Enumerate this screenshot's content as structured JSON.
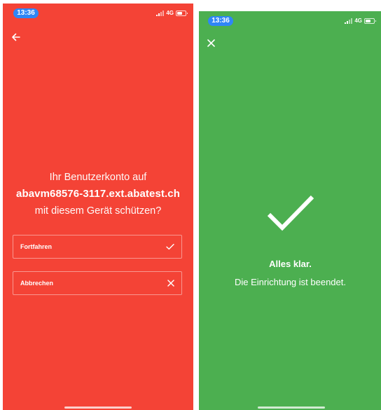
{
  "colors": {
    "left_screen_bg": "#f44336",
    "right_screen_bg": "#4caf50",
    "time_pill_bg": "#2f86f6",
    "foreground": "#ffffff"
  },
  "left_screen": {
    "status_bar": {
      "time": "13:36",
      "network": "4G",
      "icons": [
        "signal-icon",
        "battery-icon"
      ]
    },
    "back_icon": "arrow-left-icon",
    "prompt": {
      "line1": "Ihr Benutzerkonto auf",
      "account": "abavm68576-3117.ext.abatest.ch",
      "line3": "mit diesem Gerät schützen?"
    },
    "buttons": {
      "continue_label": "Fortfahren",
      "continue_icon": "checkmark-icon",
      "cancel_label": "Abbrechen",
      "cancel_icon": "close-icon"
    }
  },
  "right_screen": {
    "status_bar": {
      "time": "13:36",
      "network": "4G",
      "icons": [
        "signal-icon",
        "battery-icon"
      ]
    },
    "close_icon": "close-icon",
    "success_icon": "large-checkmark-icon",
    "title": "Alles klar.",
    "subtitle": "Die Einrichtung ist beendet."
  }
}
